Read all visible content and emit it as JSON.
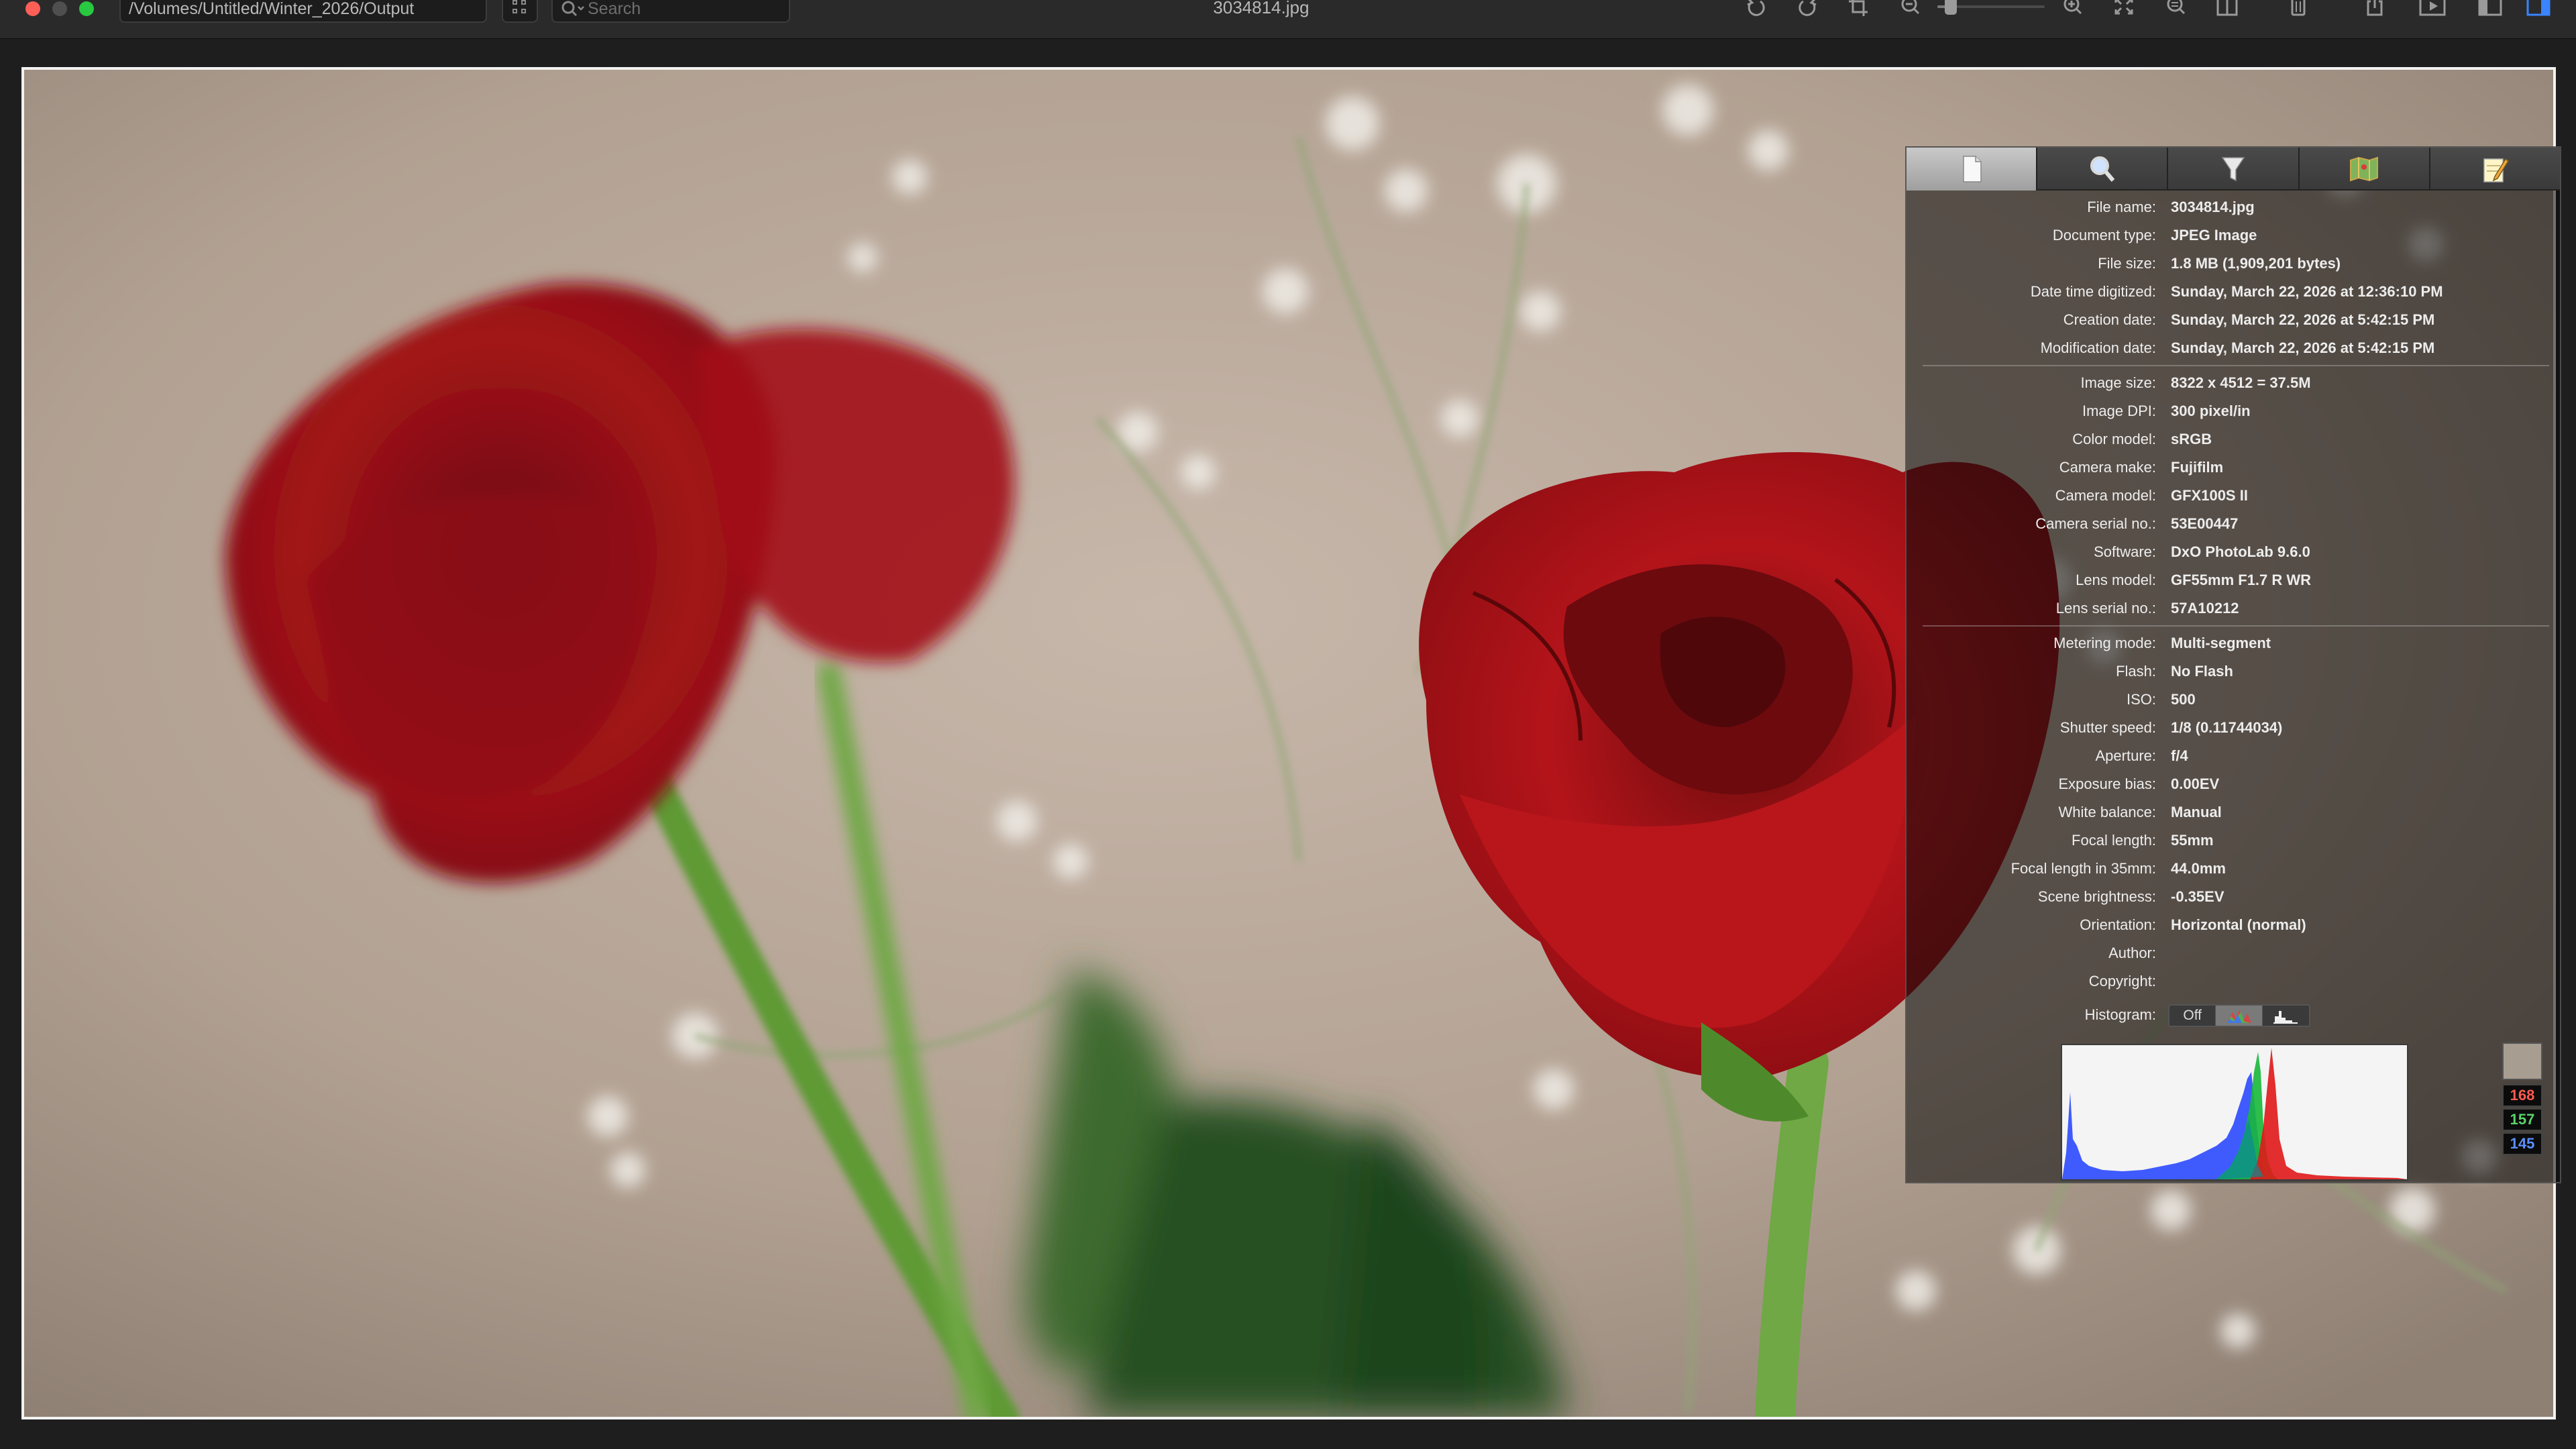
{
  "window": {
    "path": "/Volumes/Untitled/Winter_2026/Output",
    "search_placeholder": "Search",
    "title": "3034814.jpg"
  },
  "toolbar": {
    "icons": [
      "rotate-left-icon",
      "rotate-right-icon",
      "crop-icon",
      "zoom-out-icon",
      "zoom-slider",
      "zoom-in-icon",
      "fit-screen-icon",
      "actual-size-icon",
      "sidebar-split-icon",
      "trash-icon",
      "share-icon",
      "slideshow-icon",
      "panel-left-icon",
      "panel-right-icon"
    ],
    "zoom_level": 0.08
  },
  "inspector": {
    "tabs": [
      {
        "name": "file-info-tab",
        "icon": "document-icon",
        "active": true
      },
      {
        "name": "exif-tab",
        "icon": "magnifier-icon",
        "active": false
      },
      {
        "name": "lens-tab",
        "icon": "funnel-icon",
        "active": false
      },
      {
        "name": "map-tab",
        "icon": "map-icon",
        "active": false
      },
      {
        "name": "notes-tab",
        "icon": "notepad-icon",
        "active": false
      }
    ],
    "groups": [
      [
        {
          "label": "File name:",
          "value": "3034814.jpg"
        },
        {
          "label": "Document type:",
          "value": "JPEG Image"
        },
        {
          "label": "File size:",
          "value": "1.8 MB (1,909,201 bytes)"
        },
        {
          "label": "Date time digitized:",
          "value": "Sunday, March 22, 2026 at 12:36:10 PM"
        },
        {
          "label": "Creation date:",
          "value": "Sunday, March 22, 2026 at 5:42:15 PM"
        },
        {
          "label": "Modification date:",
          "value": "Sunday, March 22, 2026 at 5:42:15 PM"
        }
      ],
      [
        {
          "label": "Image size:",
          "value": "8322 x 4512 = 37.5M"
        },
        {
          "label": "Image DPI:",
          "value": "300 pixel/in"
        },
        {
          "label": "Color model:",
          "value": "sRGB"
        },
        {
          "label": "Camera make:",
          "value": "Fujifilm"
        },
        {
          "label": "Camera model:",
          "value": "GFX100S II"
        },
        {
          "label": "Camera serial no.:",
          "value": "53E00447"
        },
        {
          "label": "Software:",
          "value": "DxO PhotoLab 9.6.0"
        },
        {
          "label": "Lens model:",
          "value": "GF55mm F1.7 R WR"
        },
        {
          "label": "Lens serial no.:",
          "value": "57A10212"
        }
      ],
      [
        {
          "label": "Metering mode:",
          "value": "Multi-segment"
        },
        {
          "label": "Flash:",
          "value": "No Flash"
        },
        {
          "label": "ISO:",
          "value": "500"
        },
        {
          "label": "Shutter speed:",
          "value": "1/8 (0.11744034)"
        },
        {
          "label": "Aperture:",
          "value": "f/4"
        },
        {
          "label": "Exposure bias:",
          "value": "0.00EV"
        },
        {
          "label": "White balance:",
          "value": "Manual"
        },
        {
          "label": "Focal length:",
          "value": "55mm"
        },
        {
          "label": "Focal length in 35mm:",
          "value": "44.0mm"
        },
        {
          "label": "Scene brightness:",
          "value": "-0.35EV"
        },
        {
          "label": "Orientation:",
          "value": "Horizontal (normal)"
        },
        {
          "label": "Author:",
          "value": ""
        },
        {
          "label": "Copyright:",
          "value": ""
        }
      ]
    ],
    "histogram": {
      "label": "Histogram:",
      "modes": [
        {
          "label": "Off",
          "active": false
        },
        {
          "icon": "rgb-histogram-icon",
          "active": true
        },
        {
          "icon": "luminance-histogram-icon",
          "active": false
        }
      ],
      "sample": {
        "r": "168",
        "g": "157",
        "b": "145",
        "swatch_color": "#a89d91",
        "r_color": "#ff5a50",
        "g_color": "#59d46a",
        "b_color": "#5a90ff"
      }
    }
  }
}
